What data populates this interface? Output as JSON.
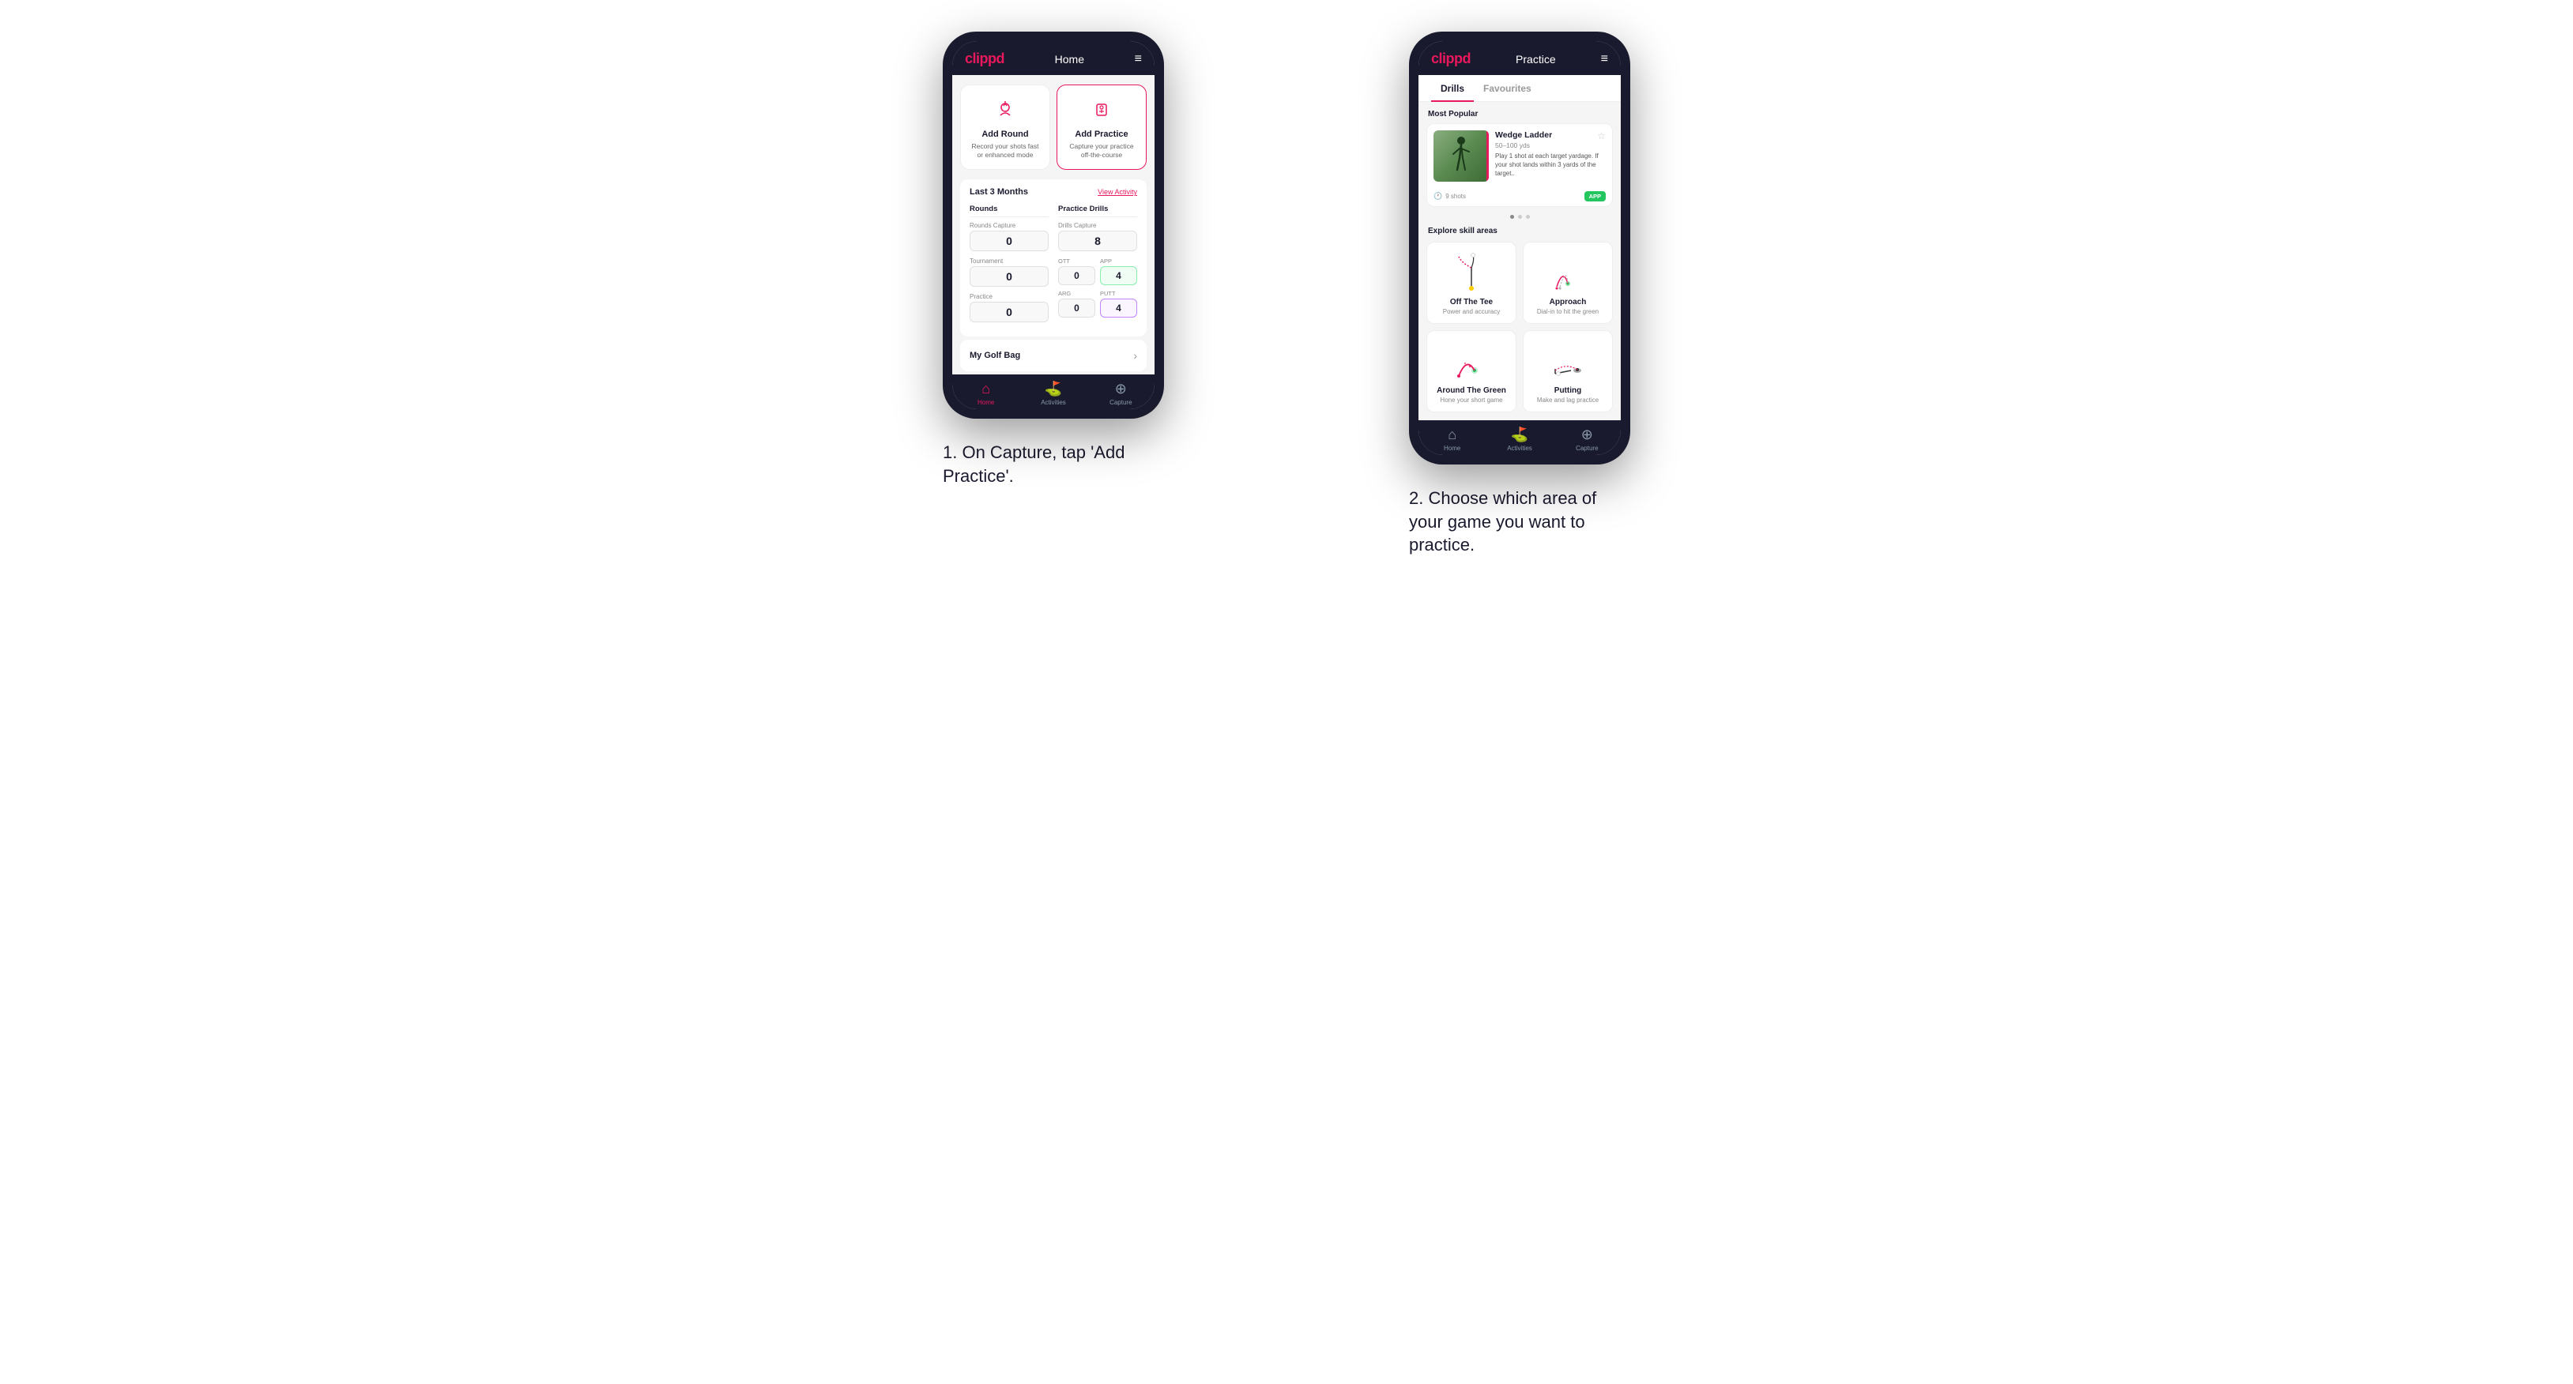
{
  "phone1": {
    "header": {
      "logo": "clippd",
      "title": "Home",
      "menu_icon": "≡"
    },
    "actions": [
      {
        "id": "add-round",
        "title": "Add Round",
        "desc": "Record your shots fast or enhanced mode",
        "highlighted": false
      },
      {
        "id": "add-practice",
        "title": "Add Practice",
        "desc": "Capture your practice off-the-course",
        "highlighted": true
      }
    ],
    "stats": {
      "period": "Last 3 Months",
      "view_activity": "View Activity",
      "rounds_col_title": "Rounds",
      "practice_col_title": "Practice Drills",
      "rounds_capture_label": "Rounds Capture",
      "rounds_capture_value": "0",
      "tournament_label": "Tournament",
      "tournament_value": "0",
      "practice_label": "Practice",
      "practice_value": "0",
      "drills_capture_label": "Drills Capture",
      "drills_capture_value": "8",
      "ott_label": "OTT",
      "ott_value": "0",
      "app_label": "APP",
      "app_value": "4",
      "arg_label": "ARG",
      "arg_value": "0",
      "putt_label": "PUTT",
      "putt_value": "4"
    },
    "golf_bag": {
      "label": "My Golf Bag"
    },
    "nav": [
      {
        "label": "Home",
        "active": true
      },
      {
        "label": "Activities",
        "active": false
      },
      {
        "label": "Capture",
        "active": false
      }
    ]
  },
  "phone2": {
    "header": {
      "logo": "clippd",
      "title": "Practice",
      "menu_icon": "≡"
    },
    "tabs": [
      {
        "label": "Drills",
        "active": true
      },
      {
        "label": "Favourites",
        "active": false
      }
    ],
    "most_popular": {
      "section_title": "Most Popular",
      "drill_name": "Wedge Ladder",
      "drill_yardage": "50–100 yds",
      "drill_desc": "Play 1 shot at each target yardage. If your shot lands within 3 yards of the target..",
      "shots_label": "9 shots",
      "app_badge": "APP"
    },
    "explore": {
      "section_title": "Explore skill areas",
      "skills": [
        {
          "name": "Off The Tee",
          "desc": "Power and accuracy",
          "visual_type": "tee"
        },
        {
          "name": "Approach",
          "desc": "Dial-in to hit the green",
          "visual_type": "approach"
        },
        {
          "name": "Around The Green",
          "desc": "Hone your short game",
          "visual_type": "atg"
        },
        {
          "name": "Putting",
          "desc": "Make and lag practice",
          "visual_type": "putt"
        }
      ]
    },
    "nav": [
      {
        "label": "Home",
        "active": false
      },
      {
        "label": "Activities",
        "active": false
      },
      {
        "label": "Capture",
        "active": false
      }
    ]
  },
  "captions": [
    "1. On Capture, tap 'Add Practice'.",
    "2. Choose which area of your game you want to practice."
  ]
}
